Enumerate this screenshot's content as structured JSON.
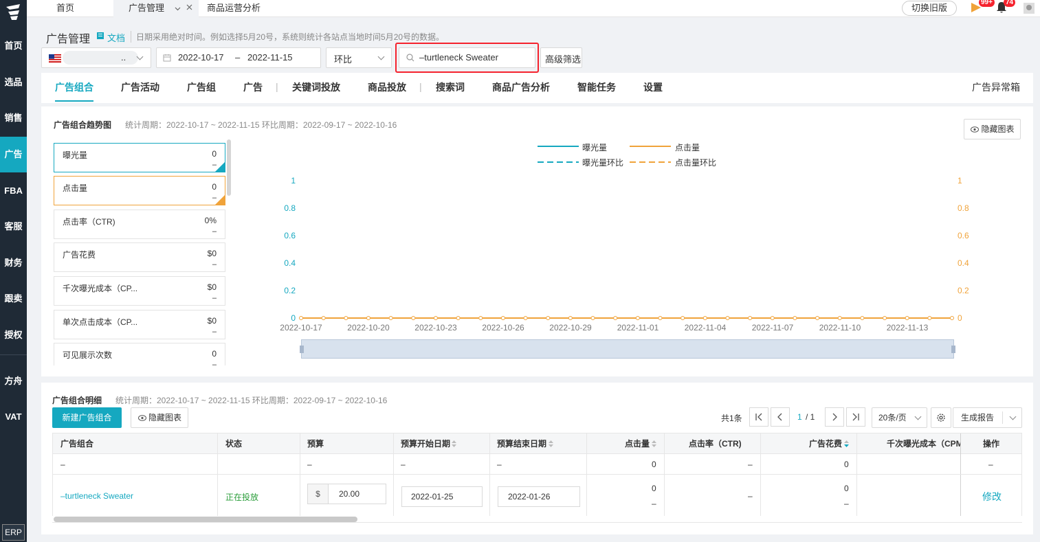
{
  "nav": {
    "items": [
      "首页",
      "选品",
      "销售",
      "广告",
      "FBA",
      "客服",
      "财务",
      "跟卖",
      "授权",
      "方舟",
      "VAT"
    ],
    "erp": "ERP",
    "active": "广告"
  },
  "topbar": {
    "tabs": [
      "首页",
      "广告管理",
      "商品运营分析"
    ],
    "old_version": "切换旧版",
    "badge1": "99+",
    "badge2": "74"
  },
  "header": {
    "title": "广告管理",
    "doc": "文档",
    "note": "日期采用绝对时间。例如选择5月20号，系统则统计各站点当地时间5月20号的数据。"
  },
  "filters": {
    "store_suffix": "..",
    "date_start": "2022-10-17",
    "date_sep": "–",
    "date_end": "2022-11-15",
    "compare": "环比",
    "search_value": "–turtleneck Sweater",
    "advanced": "高级筛选"
  },
  "subtabs": {
    "items": [
      "广告组合",
      "广告活动",
      "广告组",
      "广告",
      "关键词投放",
      "商品投放",
      "搜索词",
      "商品广告分析",
      "智能任务",
      "设置"
    ],
    "right": "广告异常箱"
  },
  "trend": {
    "title": "广告组合趋势图",
    "meta": "统计周期：2022-10-17 ~ 2022-11-15 环比周期：2022-09-17 ~ 2022-10-16",
    "hide_btn": "隐藏图表",
    "metrics": [
      {
        "label": "曝光量",
        "value": "0",
        "sub": "–"
      },
      {
        "label": "点击量",
        "value": "0",
        "sub": "–"
      },
      {
        "label": "点击率（CTR)",
        "value": "0%",
        "sub": "–"
      },
      {
        "label": "广告花费",
        "value": "$0",
        "sub": "–"
      },
      {
        "label": "千次曝光成本（CP...",
        "value": "$0",
        "sub": "–"
      },
      {
        "label": "单次点击成本（CP...",
        "value": "$0",
        "sub": "–"
      },
      {
        "label": "可见展示次数",
        "value": "0",
        "sub": "–"
      }
    ]
  },
  "chart_data": {
    "type": "line",
    "legend": [
      "曝光量",
      "点击量",
      "曝光量环比",
      "点击量环比"
    ],
    "x": [
      "2022-10-17",
      "2022-10-20",
      "2022-10-23",
      "2022-10-26",
      "2022-10-29",
      "2022-11-01",
      "2022-11-04",
      "2022-11-07",
      "2022-11-10",
      "2022-11-13"
    ],
    "series": [
      {
        "name": "曝光量",
        "values": [
          0,
          0,
          0,
          0,
          0,
          0,
          0,
          0,
          0,
          0,
          0,
          0,
          0,
          0,
          0,
          0,
          0,
          0,
          0,
          0,
          0,
          0,
          0,
          0,
          0,
          0,
          0,
          0,
          0,
          0
        ]
      },
      {
        "name": "点击量",
        "values": [
          0,
          0,
          0,
          0,
          0,
          0,
          0,
          0,
          0,
          0,
          0,
          0,
          0,
          0,
          0,
          0,
          0,
          0,
          0,
          0,
          0,
          0,
          0,
          0,
          0,
          0,
          0,
          0,
          0,
          0
        ]
      }
    ],
    "yticks": [
      "0",
      "0.2",
      "0.4",
      "0.6",
      "0.8",
      "1"
    ],
    "ylim": [
      0,
      1
    ],
    "colors": {
      "impressions": "#15a8c0",
      "clicks": "#f0a33a"
    }
  },
  "detail": {
    "title": "广告组合明细",
    "meta": "统计周期：2022-10-17 ~ 2022-11-15 环比周期：2022-09-17 ~ 2022-10-16",
    "new_btn": "新建广告组合",
    "hide_btn": "隐藏图表",
    "total": "共1条",
    "page": "1",
    "page_total": "/ 1",
    "page_size": "20条/页",
    "report": "生成报告",
    "columns": [
      "广告组合",
      "状态",
      "预算",
      "预算开始日期",
      "预算结束日期",
      "点击量",
      "点击率（CTR)",
      "广告花费",
      "千次曝光成本（CPM",
      "操作"
    ],
    "summary": {
      "c0": "–",
      "c2": "–",
      "c3": "–",
      "c4": "–",
      "clicks": "0",
      "ctr": "–",
      "spend": "0",
      "op": "–"
    },
    "row": {
      "name": "–turtleneck Sweater",
      "status": "正在投放",
      "currency": "$",
      "budget": "20.00",
      "start": "2022-01-25",
      "end": "2022-01-26",
      "clicks": "0",
      "clicks_sub": "–",
      "ctr": "–",
      "spend": "0",
      "spend_sub": "–",
      "op": "修改"
    }
  }
}
